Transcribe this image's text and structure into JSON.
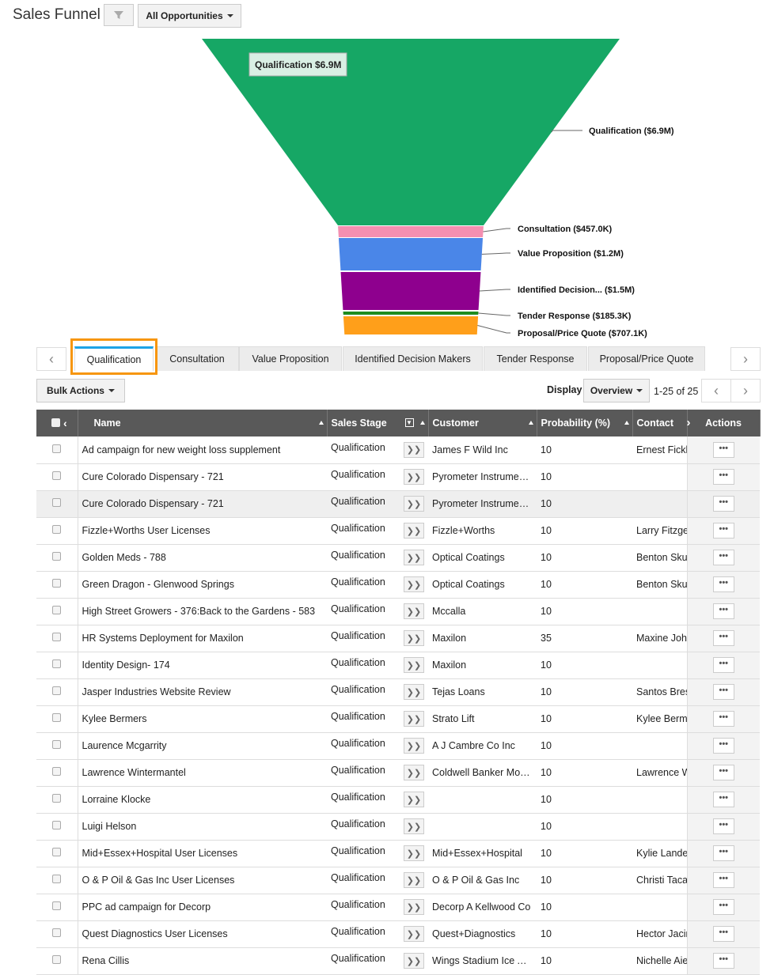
{
  "header": {
    "title": "Sales Funnel",
    "filter_icon": "funnel-icon",
    "view_select": "All Opportunities"
  },
  "funnel": {
    "tooltip": "Qualification $6.9M",
    "stages": [
      {
        "name": "Qualification",
        "value_label": "$6.9M",
        "label": "Qualification ($6.9M)",
        "color": "#16a765"
      },
      {
        "name": "Consultation",
        "value_label": "$457.0K",
        "label": "Consultation ($457.0K)",
        "color": "#f48fb1"
      },
      {
        "name": "Value Proposition",
        "value_label": "$1.2M",
        "label": "Value Proposition ($1.2M)",
        "color": "#4a86e8"
      },
      {
        "name": "Identified Decision Makers",
        "value_label": "$1.5M",
        "label": "Identified Decision... ($1.5M)",
        "color": "#8e008e"
      },
      {
        "name": "Tender Response",
        "value_label": "$185.3K",
        "label": "Tender Response ($185.3K)",
        "color": "#1e8c1e"
      },
      {
        "name": "Proposal/Price Quote",
        "value_label": "$707.1K",
        "label": "Proposal/Price Quote ($707.1K)",
        "color": "#ff9f1a"
      }
    ]
  },
  "tabs": [
    "Qualification",
    "Consultation",
    "Value Proposition",
    "Identified Decision Makers",
    "Tender Response",
    "Proposal/Price Quote"
  ],
  "toolbar": {
    "bulk_actions": "Bulk Actions",
    "display_label": "Display",
    "display_value": "Overview",
    "range": "1-25 of 25"
  },
  "table": {
    "columns": [
      "Name",
      "Sales Stage",
      "Customer",
      "Probability (%)",
      "Contact",
      "Actions"
    ],
    "rows": [
      [
        "Ad campaign for new weight loss supplement",
        "Qualification",
        "James F Wild Inc",
        "10",
        "Ernest Fickl"
      ],
      [
        "Cure Colorado Dispensary - 721",
        "Qualification",
        "Pyrometer Instrument…",
        "10",
        ""
      ],
      [
        "Cure Colorado Dispensary - 721",
        "Qualification",
        "Pyrometer Instrument…",
        "10",
        ""
      ],
      [
        "Fizzle+Worths User Licenses",
        "Qualification",
        "Fizzle+Worths",
        "10",
        "Larry Fitzge"
      ],
      [
        "Golden Meds - 788",
        "Qualification",
        "Optical Coatings",
        "10",
        "Benton Sku"
      ],
      [
        "Green Dragon - Glenwood Springs",
        "Qualification",
        "Optical Coatings",
        "10",
        "Benton Sku"
      ],
      [
        "High Street Growers - 376:Back to the Gardens - 583",
        "Qualification",
        "Mccalla",
        "10",
        ""
      ],
      [
        "HR Systems Deployment for Maxilon",
        "Qualification",
        "Maxilon",
        "35",
        "Maxine Joh"
      ],
      [
        "Identity Design- 174",
        "Qualification",
        "Maxilon",
        "10",
        ""
      ],
      [
        "Jasper Industries Website Review",
        "Qualification",
        "Tejas Loans",
        "10",
        "Santos Bres"
      ],
      [
        "Kylee Bermers",
        "Qualification",
        "Strato Lift",
        "10",
        "Kylee Berm"
      ],
      [
        "Laurence Mcgarrity",
        "Qualification",
        "A J Cambre Co Inc",
        "10",
        ""
      ],
      [
        "Lawrence Wintermantel",
        "Qualification",
        "Coldwell Banker Mo…",
        "10",
        "Lawrence W"
      ],
      [
        "Lorraine Klocke",
        "Qualification",
        "",
        "10",
        ""
      ],
      [
        "Luigi Helson",
        "Qualification",
        "",
        "10",
        ""
      ],
      [
        "Mid+Essex+Hospital User Licenses",
        "Qualification",
        "Mid+Essex+Hospital",
        "10",
        "Kylie Lande"
      ],
      [
        "O & P Oil & Gas Inc User Licenses",
        "Qualification",
        "O & P Oil & Gas Inc",
        "10",
        "Christi Taca"
      ],
      [
        "PPC ad campaign for Decorp",
        "Qualification",
        "Decorp A Kellwood Co",
        "10",
        ""
      ],
      [
        "Quest Diagnostics User Licenses",
        "Qualification",
        "Quest+Diagnostics",
        "10",
        "Hector Jacir"
      ],
      [
        "Rena Cillis",
        "Qualification",
        "Wings Stadium Ice Ar…",
        "10",
        "Nichelle Aie"
      ]
    ]
  }
}
